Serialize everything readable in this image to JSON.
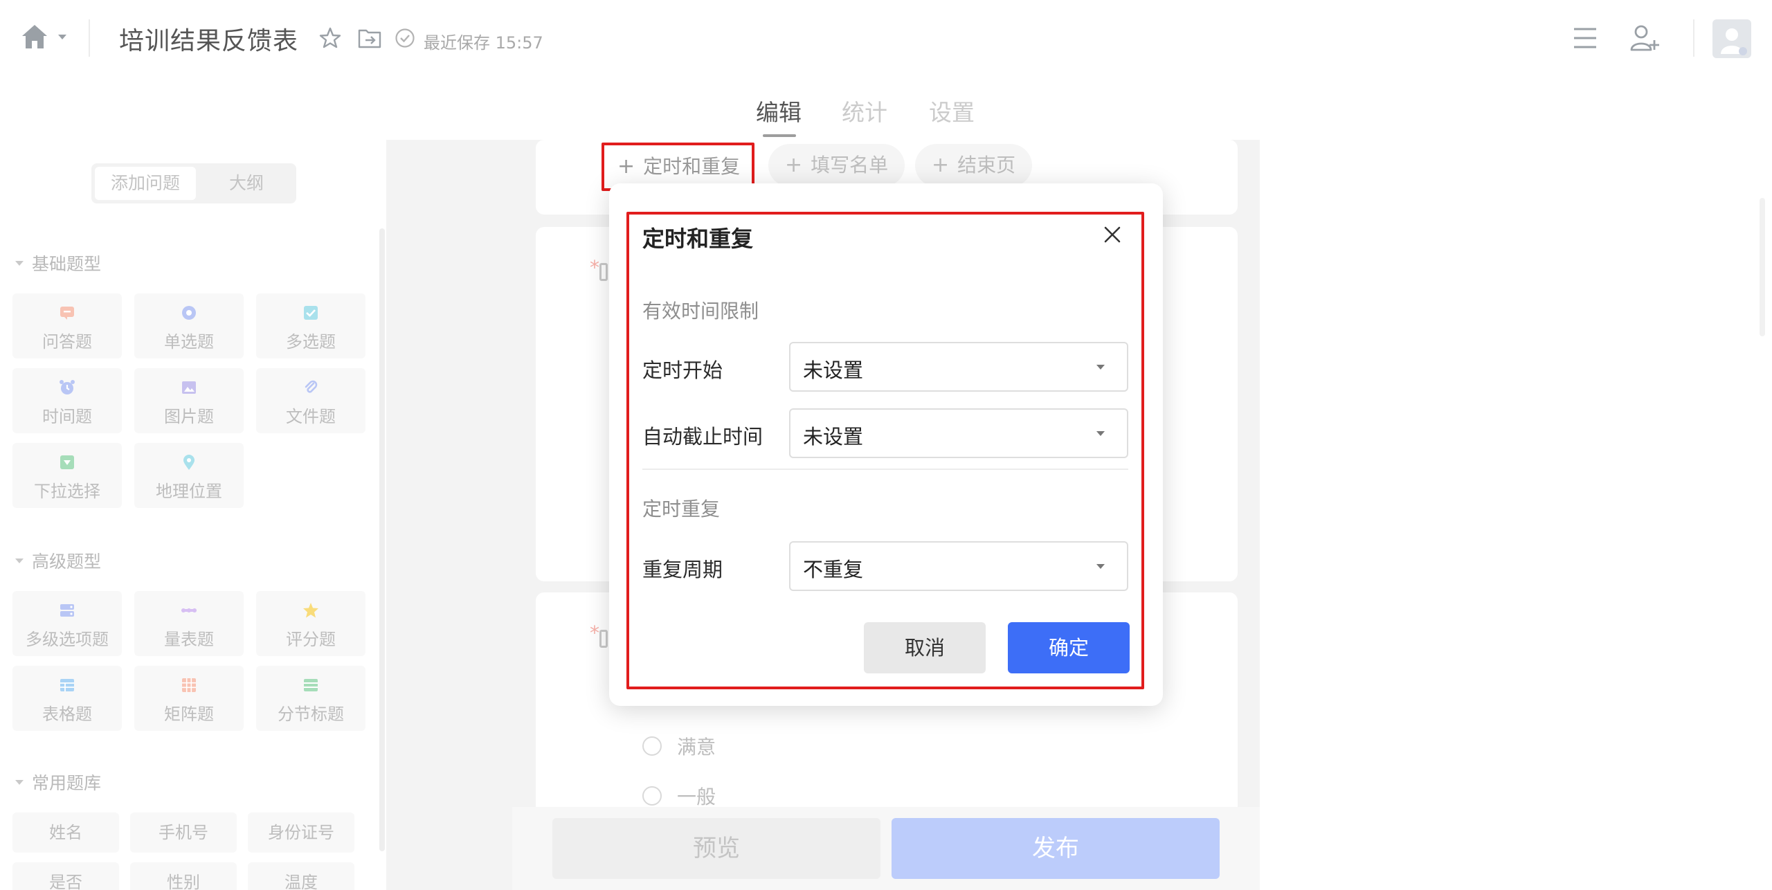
{
  "header": {
    "title": "培训结果反馈表",
    "save_status": "最近保存 15:57",
    "icons": [
      "home-icon",
      "chevron-down-icon",
      "star-icon",
      "move-to-folder-icon",
      "check-circle-icon",
      "menu-icon",
      "add-user-icon",
      "avatar"
    ]
  },
  "tabs": [
    "编辑",
    "统计",
    "设置"
  ],
  "left_panel": {
    "segment": [
      "添加问题",
      "大纲"
    ],
    "sections": {
      "basic": {
        "title": "基础题型",
        "items": [
          "问答题",
          "单选题",
          "多选题",
          "时间题",
          "图片题",
          "文件题",
          "下拉选择",
          "地理位置"
        ]
      },
      "advanced": {
        "title": "高级题型",
        "items": [
          "多级选项题",
          "量表题",
          "评分题",
          "表格题",
          "矩阵题",
          "分节标题"
        ]
      },
      "library": {
        "title": "常用题库",
        "items": [
          "姓名",
          "手机号",
          "身份证号",
          "是否",
          "性别",
          "温度"
        ]
      }
    }
  },
  "canvas": {
    "pills": [
      "定时和重复",
      "填写名单",
      "结束页"
    ],
    "options": [
      "满意",
      "一般"
    ],
    "preview": "预览",
    "publish": "发布"
  },
  "modal": {
    "title": "定时和重复",
    "section_valid": "有效时间限制",
    "start_label": "定时开始",
    "start_value": "未设置",
    "deadline_label": "自动截止时间",
    "deadline_value": "未设置",
    "section_repeat": "定时重复",
    "repeat_label": "重复周期",
    "repeat_value": "不重复",
    "cancel": "取消",
    "ok": "确定"
  },
  "colors": {
    "primary": "#3d6ef7",
    "highlight": "#e11d1d",
    "publish_disabled": "#bcccfb"
  }
}
